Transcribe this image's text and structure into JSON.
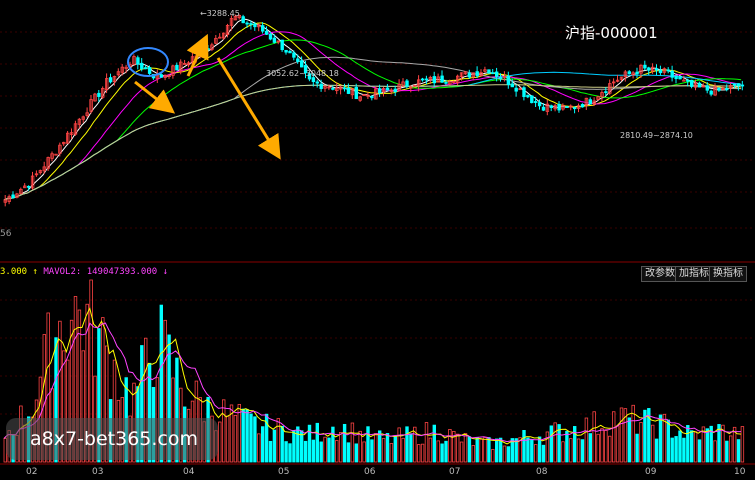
{
  "index_title": "沪指-000001",
  "side_label": "56",
  "annotations": {
    "high": "3288.45",
    "mid_level": "3052.62~3048.18",
    "low_level": "2810.49~2874.10"
  },
  "volume_legend": {
    "mavol1_value": "3.000",
    "mavol1_arrow": "↑",
    "mavol2_label": "MAVOL2:",
    "mavol2_value": "149047393.000",
    "mavol2_arrow": "↓"
  },
  "toolbar": {
    "params_button": "改参数",
    "add_indicator_button": "加指标",
    "switch_indicator_button": "换指标"
  },
  "month_labels": [
    "02",
    "03",
    "04",
    "05",
    "06",
    "07",
    "08",
    "09",
    "10"
  ],
  "watermark": "a8x7-bet365.com",
  "colors": {
    "up_candle": "#ff4444",
    "down_candle": "#00ffff",
    "ma5": "#ffffff",
    "ma10": "#ffff00",
    "ma20": "#ff00ff",
    "ma30": "#00ff00",
    "ma60": "#aaaaaa",
    "ma120": "#00ccff",
    "ma250": "#cccc88",
    "arrow": "#ffaa00",
    "circle": "#3388ff"
  },
  "chart_data": {
    "type": "candlestick",
    "xlabels": [
      "02",
      "03",
      "04",
      "05",
      "06",
      "07",
      "08",
      "09",
      "10"
    ],
    "price_path": [
      2480,
      2560,
      2700,
      2850,
      3000,
      3100,
      3020,
      3080,
      3160,
      3288,
      3240,
      3150,
      3000,
      2980,
      2940,
      2960,
      3000,
      3010,
      3030,
      3060,
      2990,
      2900,
      2880,
      2920,
      3010,
      3060,
      3040,
      2980,
      2960,
      2990
    ],
    "volume_path": [
      30,
      60,
      150,
      170,
      120,
      70,
      140,
      80,
      60,
      50,
      40,
      35,
      30,
      40,
      30,
      25,
      30,
      35,
      25,
      20,
      25,
      30,
      35,
      40,
      50,
      45,
      40,
      30,
      35,
      30
    ]
  }
}
